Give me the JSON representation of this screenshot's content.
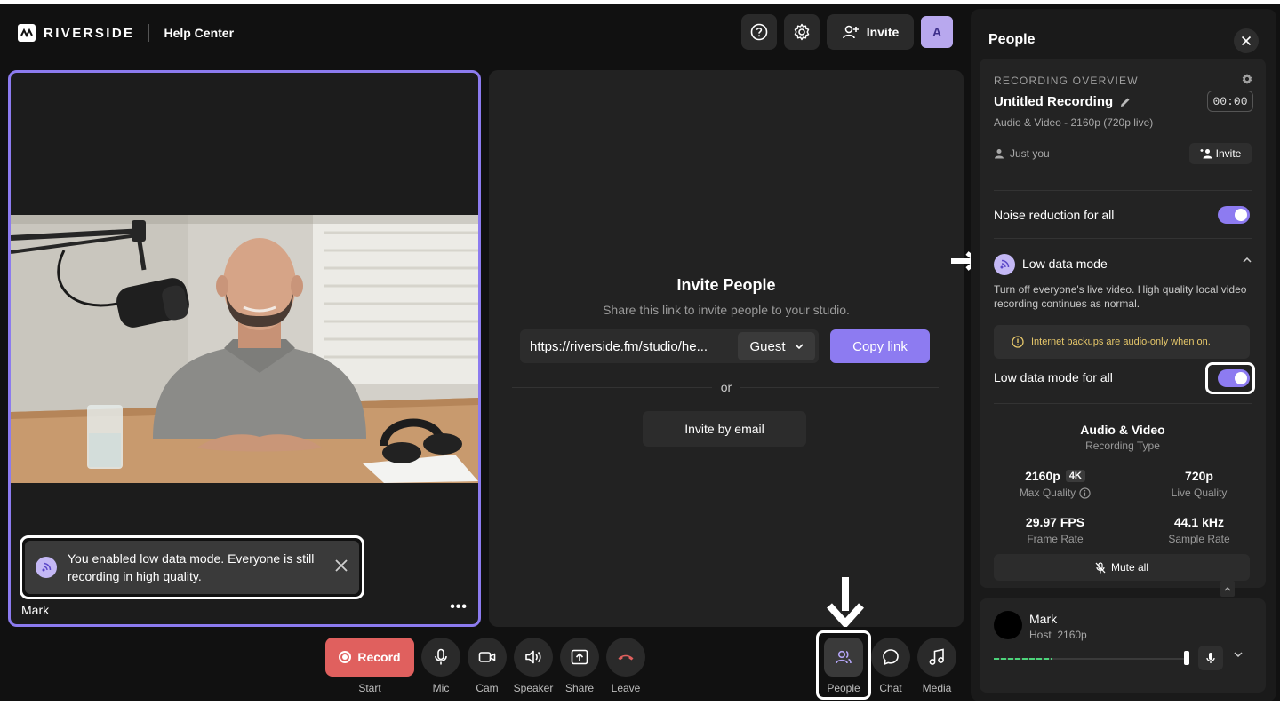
{
  "header": {
    "logo_text": "RIVERSIDE",
    "help_center": "Help Center",
    "invite_label": "Invite",
    "avatar_initial": "A"
  },
  "video": {
    "participant_name": "Mark",
    "more_label": "•••"
  },
  "toast": {
    "message": "You enabled low data mode. Everyone is still recording in high quality."
  },
  "invite_panel": {
    "title": "Invite People",
    "subtitle": "Share this link to invite people to your studio.",
    "link": "https://riverside.fm/studio/he...",
    "role": "Guest",
    "copy_label": "Copy link",
    "or_label": "or",
    "email_label": "Invite by email"
  },
  "controls": {
    "record_label": "Record",
    "start_label": "Start",
    "mic_label": "Mic",
    "cam_label": "Cam",
    "speaker_label": "Speaker",
    "share_label": "Share",
    "leave_label": "Leave",
    "people_label": "People",
    "chat_label": "Chat",
    "media_label": "Media"
  },
  "sidebar": {
    "title": "People",
    "overview_label": "RECORDING OVERVIEW",
    "recording_title": "Untitled Recording",
    "timer": "00:00",
    "recording_meta": "Audio & Video - 2160p (720p live)",
    "just_you": "Just you",
    "invite_label": "Invite",
    "noise_reduction_label": "Noise reduction for all",
    "noise_reduction_on": true,
    "low_data_title": "Low data mode",
    "low_data_desc": "Turn off everyone's live video. High quality local video recording continues as normal.",
    "warning": "Internet backups are audio-only when on.",
    "low_data_all_label": "Low data mode for all",
    "low_data_all_on": true,
    "recording_type_value": "Audio & Video",
    "recording_type_label": "Recording Type",
    "max_quality_value": "2160p",
    "max_quality_badge": "4K",
    "max_quality_label": "Max Quality",
    "live_quality_value": "720p",
    "live_quality_label": "Live Quality",
    "frame_rate_value": "29.97 FPS",
    "frame_rate_label": "Frame Rate",
    "sample_rate_value": "44.1 kHz",
    "sample_rate_label": "Sample Rate",
    "mute_all_label": "Mute all",
    "person": {
      "name": "Mark",
      "role": "Host",
      "quality": "2160p",
      "audio_level": 0.3
    }
  },
  "colors": {
    "accent": "#8d7bf1",
    "record": "#e0605e",
    "background": "#111111",
    "warning": "#e6c76a"
  }
}
